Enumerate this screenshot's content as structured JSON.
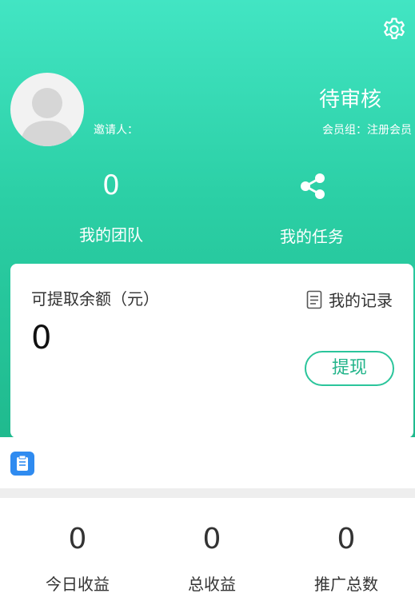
{
  "header": {
    "settings_icon": "gear-icon",
    "avatar_icon": "user-avatar-placeholder",
    "inviter_label": "邀请人：",
    "status_text": "待审核",
    "member_group": "会员组：注册会员",
    "team": {
      "count": "0",
      "label": "我的团队"
    },
    "task": {
      "icon": "share-icon",
      "label": "我的任务"
    }
  },
  "balance_card": {
    "title": "可提取余额（元）",
    "amount": "0",
    "record_label": "我的记录",
    "record_icon": "document-icon",
    "withdraw_label": "提现"
  },
  "notice": {
    "icon": "clipboard-icon"
  },
  "stats": [
    {
      "value": "0",
      "label": "今日收益"
    },
    {
      "value": "0",
      "label": "总收益"
    },
    {
      "value": "0",
      "label": "推广总数"
    }
  ],
  "colors": {
    "gradient_top": "#42e5c3",
    "gradient_bottom": "#1fb98d",
    "accent": "#2bc59b",
    "notice_icon": "#2f8bf0"
  }
}
